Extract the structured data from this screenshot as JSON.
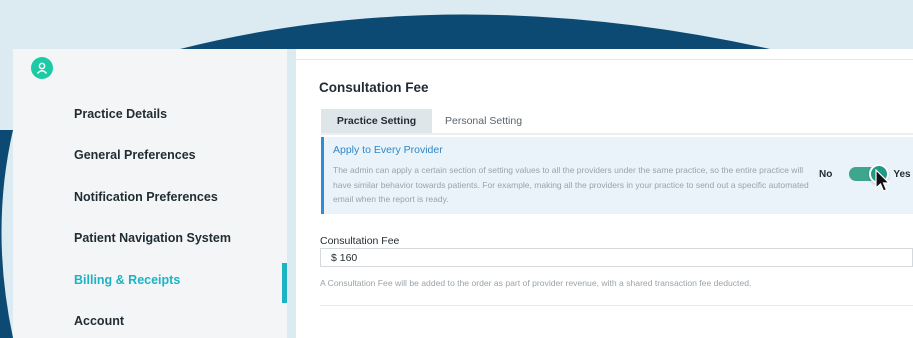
{
  "colors": {
    "background": "#dcebf1",
    "banner_blue": "#0d4a73",
    "accent_teal": "#1db3c2",
    "toggle_green": "#1f9a84",
    "info_blue": "#2f86c9"
  },
  "sidebar": {
    "logo_icon": "user-icon",
    "items": [
      {
        "label": "Practice Details",
        "active": false
      },
      {
        "label": "General Preferences",
        "active": false
      },
      {
        "label": "Notification Preferences",
        "active": false
      },
      {
        "label": "Patient Navigation System",
        "active": false
      },
      {
        "label": "Billing & Receipts",
        "active": true
      },
      {
        "label": "Account",
        "active": false
      }
    ]
  },
  "main": {
    "title": "Consultation Fee",
    "tabs": [
      {
        "label": "Practice Setting",
        "active": true
      },
      {
        "label": "Personal Setting",
        "active": false
      }
    ],
    "apply_panel": {
      "title": "Apply to Every Provider",
      "description": "The admin can apply a certain section of setting values to all the providers under the same practice, so the entire practice will have similar behavior towards patients. For example, making all the providers in your practice to send out a specific automated email when the report is ready.",
      "toggle": {
        "off_label": "No",
        "on_label": "Yes",
        "state": "on"
      }
    },
    "fee_field": {
      "label": "Consultation Fee",
      "value": "$ 160",
      "help": "A Consultation Fee will be added to the order as part of provider revenue, with a shared transaction fee deducted."
    }
  }
}
